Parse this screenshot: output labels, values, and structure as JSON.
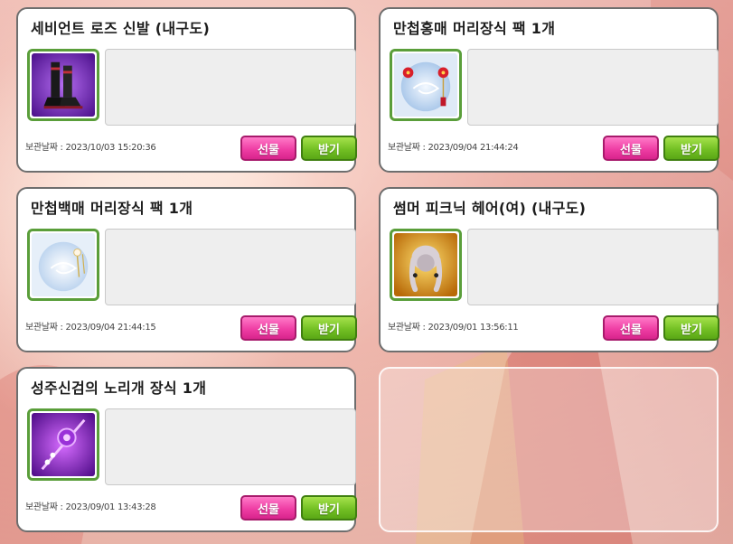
{
  "storage": {
    "date_prefix": "보관날짜 :",
    "items": [
      {
        "title": "세비언트 로즈 신발 (내구도)",
        "date": "2023/10/03 15:20:36",
        "gift_label": "선물",
        "receive_label": "받기",
        "icon": "black-boots-icon",
        "icon_bg": "#6a1fb0"
      },
      {
        "title": "만첩홍매 머리장식 팩 1개",
        "date": "2023/09/04 21:44:24",
        "gift_label": "선물",
        "receive_label": "받기",
        "icon": "red-plum-hair-ornament-pack-icon",
        "icon_bg": "#a9c8ea"
      },
      {
        "title": "만첩백매 머리장식 팩 1개",
        "date": "2023/09/04 21:44:15",
        "gift_label": "선물",
        "receive_label": "받기",
        "icon": "white-plum-hair-ornament-pack-icon",
        "icon_bg": "#b8d4ee"
      },
      {
        "title": "썸머 피크닉 헤어(여) (내구도)",
        "date": "2023/09/01 13:56:11",
        "gift_label": "선물",
        "receive_label": "받기",
        "icon": "picnic-hair-icon",
        "icon_bg": "#e0a010"
      },
      {
        "title": "성주신검의 노리개 장식 1개",
        "date": "2023/09/01 13:43:28",
        "gift_label": "선물",
        "receive_label": "받기",
        "icon": "purple-norigae-ornament-icon",
        "icon_bg": "#8a20c8"
      }
    ]
  },
  "colors": {
    "gift_button": "#ef3ea4",
    "receive_button": "#73c024",
    "icon_border": "#5a9e3a"
  }
}
